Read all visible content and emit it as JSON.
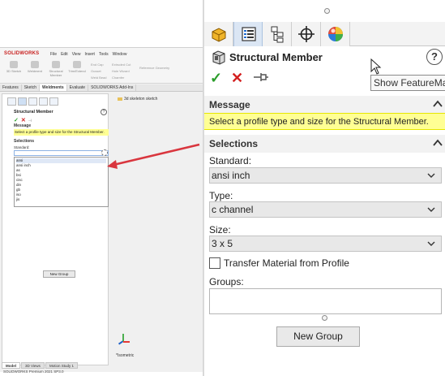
{
  "mini": {
    "logo": "SOLIDWORKS",
    "menus": [
      "File",
      "Edit",
      "View",
      "Insert",
      "Tools",
      "Window"
    ],
    "ribbon": [
      "3D Sketch",
      "Weldment",
      "Structural Member",
      "Trim/Extend",
      "End Cap",
      "Gusset",
      "Extruded Cut",
      "Hole Wizard",
      "Chamfer",
      "Weld Bead",
      "Reference Geometry"
    ],
    "tabs": [
      "Features",
      "Sketch",
      "Weldments",
      "Evaluate",
      "SOLIDWORKS Add-Ins"
    ],
    "active_tab": "Weldments",
    "pm_title": "Structural Member",
    "message_header": "Message",
    "message_text": "Select a profile type and size for the Structural Member.",
    "selections_header": "Selections",
    "standard_label": "Standard:",
    "standard_options": [
      "ansi",
      "ansi inch",
      "as",
      "bsi",
      "cisc",
      "din",
      "gb",
      "iso",
      "jis"
    ],
    "new_group": "New Group",
    "tree_item": "3d skeleton sketch",
    "view_label": "*Isometric",
    "bottom_tabs": [
      "Model",
      "3D Views",
      "Motion Study 1"
    ],
    "status": "SOLIDWORKS Premium 2021 SP3.0"
  },
  "panel": {
    "title": "Structural Member",
    "help": "?",
    "tooltip": "Show FeatureManager",
    "message": {
      "header": "Message",
      "text": "Select a profile type and size for the Structural Member."
    },
    "selections": {
      "header": "Selections",
      "standard_label": "Standard:",
      "standard_value": "ansi inch",
      "type_label": "Type:",
      "type_value": "c channel",
      "size_label": "Size:",
      "size_value": "3 x 5",
      "transfer_label": "Transfer Material from Profile",
      "transfer_checked": false,
      "groups_label": "Groups:",
      "new_group": "New Group"
    },
    "tabs": [
      "featuremanager-icon",
      "propertymanager-icon",
      "configurationmanager-icon",
      "dimxpert-icon",
      "display-manager-icon"
    ],
    "colors": {
      "ok": "#2a9d2a",
      "cancel": "#d32020",
      "message_bg": "#ffff94",
      "callout_arrow": "#d9363e"
    }
  }
}
